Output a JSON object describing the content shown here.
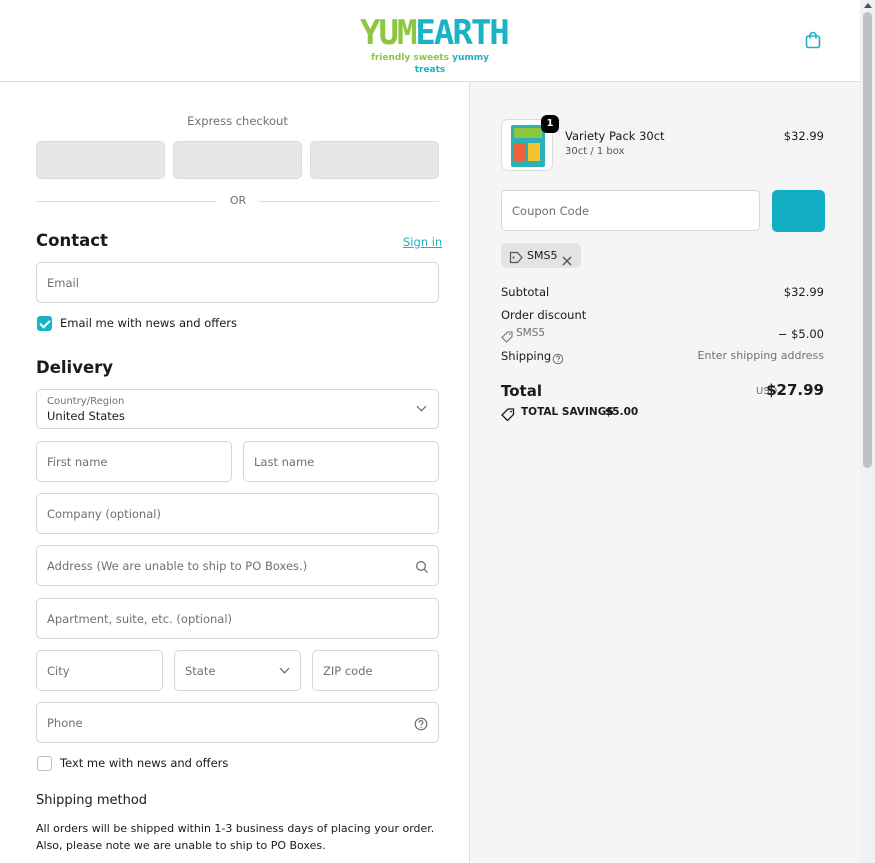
{
  "brand": {
    "wordmark_left": "YUM",
    "wordmark_right": "EARTH",
    "tagline_left": "friendly sweets",
    "tagline_right": "yummy treats"
  },
  "express": {
    "label": "Express checkout",
    "divider": "OR"
  },
  "contact": {
    "title": "Contact",
    "sign_in": "Sign in",
    "email_placeholder": "Email",
    "news_label": "Email me with news and offers"
  },
  "delivery": {
    "title": "Delivery",
    "country_label": "Country/Region",
    "country_value": "United States",
    "first_name": "First name",
    "last_name": "Last name",
    "company": "Company (optional)",
    "address": "Address (We are unable to ship to PO Boxes.)",
    "apartment": "Apartment, suite, etc. (optional)",
    "city": "City",
    "state": "State",
    "zip": "ZIP code",
    "phone": "Phone",
    "text_label": "Text me with news and offers"
  },
  "shipping": {
    "title": "Shipping method",
    "note": "All orders will be shipped within 1-3 business days of placing your order. Also, please note we are unable to ship to PO Boxes."
  },
  "cart": {
    "quantity": "1",
    "product_name": "Variety Pack 30ct",
    "product_variant": "30ct / 1 box",
    "product_price": "$32.99",
    "coupon_placeholder": "Coupon Code",
    "applied_code": "SMS5"
  },
  "summary": {
    "subtotal_label": "Subtotal",
    "subtotal": "$32.99",
    "discount_label": "Order discount",
    "discount_code": "SMS5",
    "discount_value": "− $5.00",
    "shipping_label": "Shipping",
    "shipping_value": "Enter shipping address",
    "total_label": "Total",
    "currency": "USD",
    "total": "$27.99",
    "savings_label": "TOTAL SAVINGS",
    "savings": "$5.00"
  },
  "colors": {
    "accent": "#1ab2c5",
    "brand_green": "#8dc63f",
    "panel": "#f5f5f5"
  }
}
